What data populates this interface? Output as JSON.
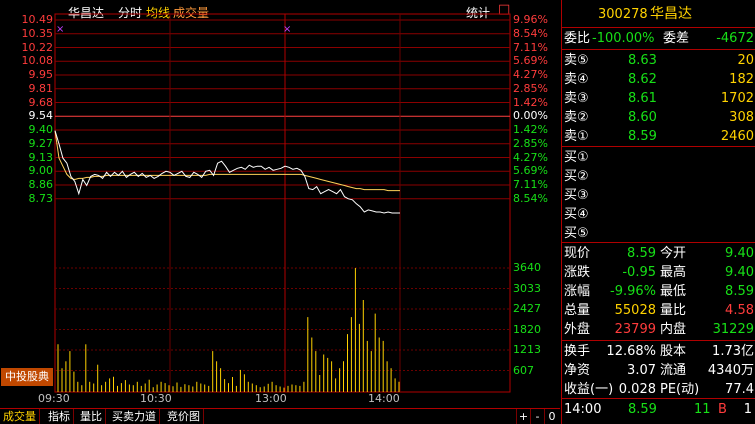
{
  "header": {
    "stock_name": "华昌达",
    "mode": "分时",
    "avg_line": "均线",
    "volume": "成交量",
    "stats": "统计",
    "close_box": "□"
  },
  "y_left_prices": [
    "10.49",
    "10.35",
    "10.22",
    "10.08",
    "9.95",
    "9.81",
    "9.68",
    "9.54",
    "9.40",
    "9.27",
    "9.13",
    "9.00",
    "8.86",
    "8.73"
  ],
  "y_right_pcts": [
    "9.96%",
    "8.54%",
    "7.11%",
    "5.69%",
    "4.27%",
    "2.85%",
    "1.42%",
    "0.00%",
    "1.42%",
    "2.85%",
    "4.27%",
    "5.69%",
    "7.11%",
    "8.54%"
  ],
  "volume_axis": [
    "3640",
    "3033",
    "2427",
    "1820",
    "1213",
    "607"
  ],
  "x_labels": [
    "09:30",
    "10:30",
    "13:00",
    "14:00"
  ],
  "markers": {
    "left": "×",
    "right": "×"
  },
  "broker_badge": "中投股典",
  "bottom_tabs": [
    {
      "label": "成交量"
    },
    {
      "label": "指标"
    },
    {
      "label": "量比"
    },
    {
      "label": "买卖力道"
    },
    {
      "label": "竞价图"
    }
  ],
  "bottom_controls": {
    "plus": "+",
    "minus": "-",
    "zero": "0"
  },
  "quote": {
    "code": "300278",
    "name": "华昌达",
    "webi_label": "委比",
    "webi_value": "-100.00%",
    "wecha_label": "委差",
    "wecha_value": "-4672",
    "asks": [
      {
        "label": "卖⑤",
        "price": "8.63",
        "vol": "20"
      },
      {
        "label": "卖④",
        "price": "8.62",
        "vol": "182"
      },
      {
        "label": "卖③",
        "price": "8.61",
        "vol": "1702"
      },
      {
        "label": "卖②",
        "price": "8.60",
        "vol": "308"
      },
      {
        "label": "卖①",
        "price": "8.59",
        "vol": "2460"
      }
    ],
    "bids": [
      {
        "label": "买①"
      },
      {
        "label": "买②"
      },
      {
        "label": "买③"
      },
      {
        "label": "买④"
      },
      {
        "label": "买⑤"
      }
    ],
    "stats": [
      [
        {
          "label": "现价",
          "value": "8.59",
          "color": "#17e017"
        },
        {
          "label": "今开",
          "value": "9.40",
          "color": "#17e017"
        }
      ],
      [
        {
          "label": "涨跌",
          "value": "-0.95",
          "color": "#17e017"
        },
        {
          "label": "最高",
          "value": "9.40",
          "color": "#17e017"
        }
      ],
      [
        {
          "label": "涨幅",
          "value": "-9.96%",
          "color": "#17e017"
        },
        {
          "label": "最低",
          "value": "8.59",
          "color": "#17e017"
        }
      ],
      [
        {
          "label": "总量",
          "value": "55028",
          "color": "#ffd200"
        },
        {
          "label": "量比",
          "value": "4.58",
          "color": "#ff3c3c"
        }
      ],
      [
        {
          "label": "外盘",
          "value": "23799",
          "color": "#ff3c3c"
        },
        {
          "label": "内盘",
          "value": "31229",
          "color": "#17e017"
        }
      ]
    ],
    "stats2": [
      [
        {
          "label": "换手",
          "value": "12.68%"
        },
        {
          "label": "股本",
          "value": "1.73亿"
        }
      ],
      [
        {
          "label": "净资",
          "value": "3.07"
        },
        {
          "label": "流通",
          "value": "4340万"
        }
      ],
      [
        {
          "label": "收益(一)",
          "value": "0.028"
        },
        {
          "label": "PE(动)",
          "value": "77.4"
        }
      ]
    ],
    "tick": {
      "time": "14:00",
      "price": "8.59",
      "vol": "11",
      "side": "B",
      "count": "1"
    }
  },
  "price_line": [
    9.4,
    9.27,
    9.13,
    9.08,
    8.95,
    8.9,
    8.78,
    8.92,
    8.86,
    8.95,
    8.97,
    8.96,
    8.93,
    8.99,
    8.95,
    8.99,
    8.96,
    9.0,
    8.94,
    8.97,
    8.99,
    8.95,
    8.98,
    8.94,
    8.96,
    8.93,
    8.95,
    8.98,
    9.0,
    8.99,
    8.96,
    8.98,
    9.0,
    8.95,
    8.94,
    8.99,
    8.97,
    8.94,
    9.0,
    9.01,
    8.96,
    9.08,
    9.1,
    9.05,
    8.99,
    9.01,
    9.03,
    9.04,
    9.02,
    9.06,
    9.04,
    9.05,
    9.05,
    9.02,
    9.04,
    9.01,
    9.02,
    9.03,
    9.05,
    9.04,
    9.02,
    9.03,
    9.01,
    8.95,
    8.83,
    8.82,
    8.85,
    8.78,
    8.8,
    8.82,
    8.8,
    8.78,
    8.82,
    8.75,
    8.73,
    8.72,
    8.68,
    8.65,
    8.6,
    8.62,
    8.61,
    8.6,
    8.6,
    8.59,
    8.6,
    8.59,
    8.59,
    8.59
  ],
  "avg_line": [
    9.4,
    9.13,
    9.05,
    8.97,
    8.93,
    8.92,
    8.93,
    8.93,
    8.94,
    8.94,
    8.95,
    8.95,
    8.95,
    8.96,
    8.96,
    8.96,
    8.96,
    8.96,
    8.96,
    8.96,
    8.96,
    8.96,
    8.96,
    8.96,
    8.96,
    8.96,
    8.96,
    8.96,
    8.96,
    8.96,
    8.96,
    8.96,
    8.96,
    8.96,
    8.96,
    8.96,
    8.96,
    8.96,
    8.96,
    8.97,
    8.97,
    8.97,
    8.97,
    8.97,
    8.97,
    8.97,
    8.97,
    8.97,
    8.97,
    8.97,
    8.97,
    8.97,
    8.97,
    8.97,
    8.97,
    8.97,
    8.97,
    8.97,
    8.97,
    8.97,
    8.97,
    8.97,
    8.97,
    8.96,
    8.95,
    8.94,
    8.93,
    8.92,
    8.91,
    8.9,
    8.89,
    8.88,
    8.87,
    8.86,
    8.85,
    8.84,
    8.83,
    8.83,
    8.82,
    8.82,
    8.82,
    8.82,
    8.82,
    8.82,
    8.81,
    8.81,
    8.81,
    8.81
  ],
  "volumes": [
    1400,
    700,
    900,
    1200,
    600,
    300,
    200,
    1400,
    300,
    250,
    800,
    200,
    300,
    400,
    450,
    180,
    260,
    350,
    220,
    200,
    300,
    180,
    250,
    360,
    140,
    220,
    300,
    260,
    200,
    170,
    280,
    150,
    230,
    200,
    160,
    300,
    250,
    220,
    180,
    1200,
    900,
    700,
    380,
    260,
    440,
    180,
    650,
    520,
    300,
    250,
    200,
    140,
    160,
    240,
    300,
    200,
    160,
    130,
    180,
    220,
    200,
    180,
    300,
    2200,
    1600,
    1200,
    500,
    1100,
    1000,
    900,
    400,
    700,
    900,
    1700,
    2200,
    3640,
    2000,
    2700,
    1500,
    1200,
    2300,
    1600,
    1500,
    900,
    700,
    400,
    300
  ]
}
